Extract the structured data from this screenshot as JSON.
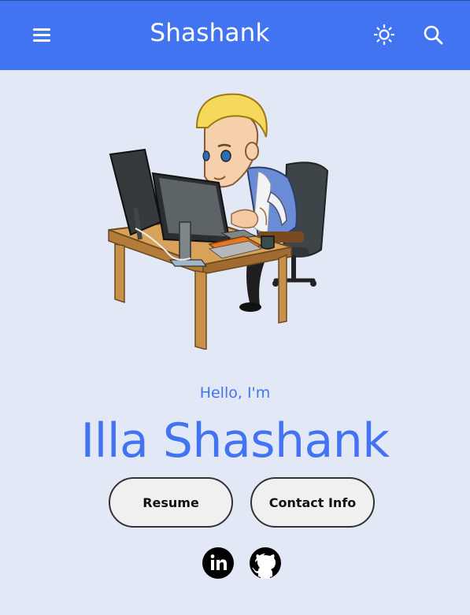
{
  "header": {
    "brand": "Shashank",
    "background_color": "#4273f0",
    "icons": [
      "menu-icon",
      "sun-icon",
      "search-icon"
    ]
  },
  "hero": {
    "illustration": "developer-at-computer-illustration",
    "greeting": "Hello, I'm",
    "name": "Illa Shashank",
    "accent_color": "#4273f0"
  },
  "actions": {
    "resume_label": "Resume",
    "contact_label": "Contact Info"
  },
  "social": {
    "icons": [
      "linkedin-icon",
      "github-icon"
    ]
  },
  "page": {
    "background_color": "#e3e8f6"
  }
}
